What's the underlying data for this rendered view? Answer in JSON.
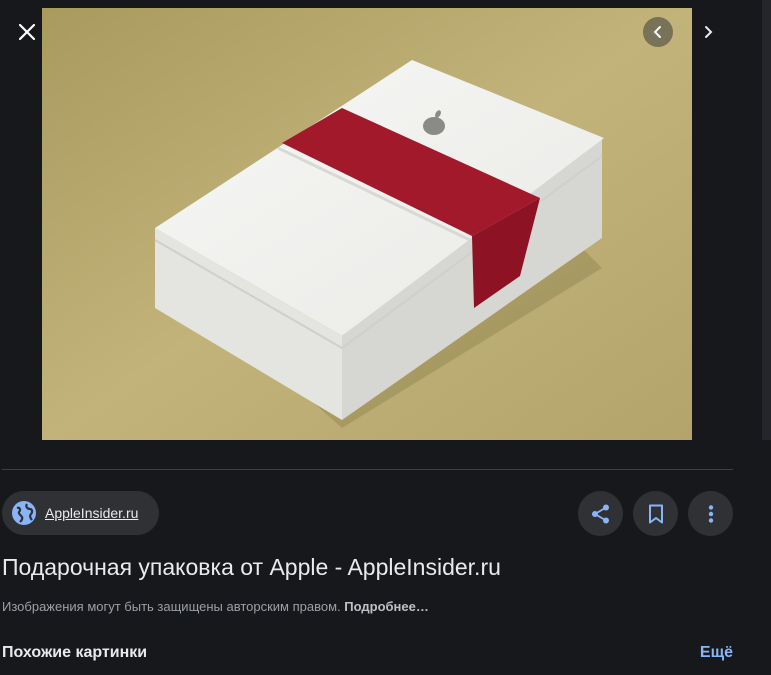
{
  "viewer": {
    "close_icon": "close-icon",
    "prev_icon": "chevron-left-icon",
    "next_icon": "chevron-right-icon"
  },
  "image": {
    "subject": "white gift box with red band and apple logo"
  },
  "source": {
    "name": "AppleInsider.ru",
    "icon": "globe-icon"
  },
  "actions": {
    "share_icon": "share-icon",
    "save_icon": "bookmark-icon",
    "more_icon": "more-vert-icon"
  },
  "title": "Подарочная упаковка от Apple - AppleInsider.ru",
  "notice": {
    "text": "Изображения могут быть защищены авторским правом.",
    "link": "Подробнее…"
  },
  "similar": {
    "heading": "Похожие картинки",
    "more_label": "Ещё"
  },
  "colors": {
    "background": "#17181c",
    "chip": "#303134",
    "accent": "#8ab4f8",
    "globe": "#8ab4f8"
  }
}
